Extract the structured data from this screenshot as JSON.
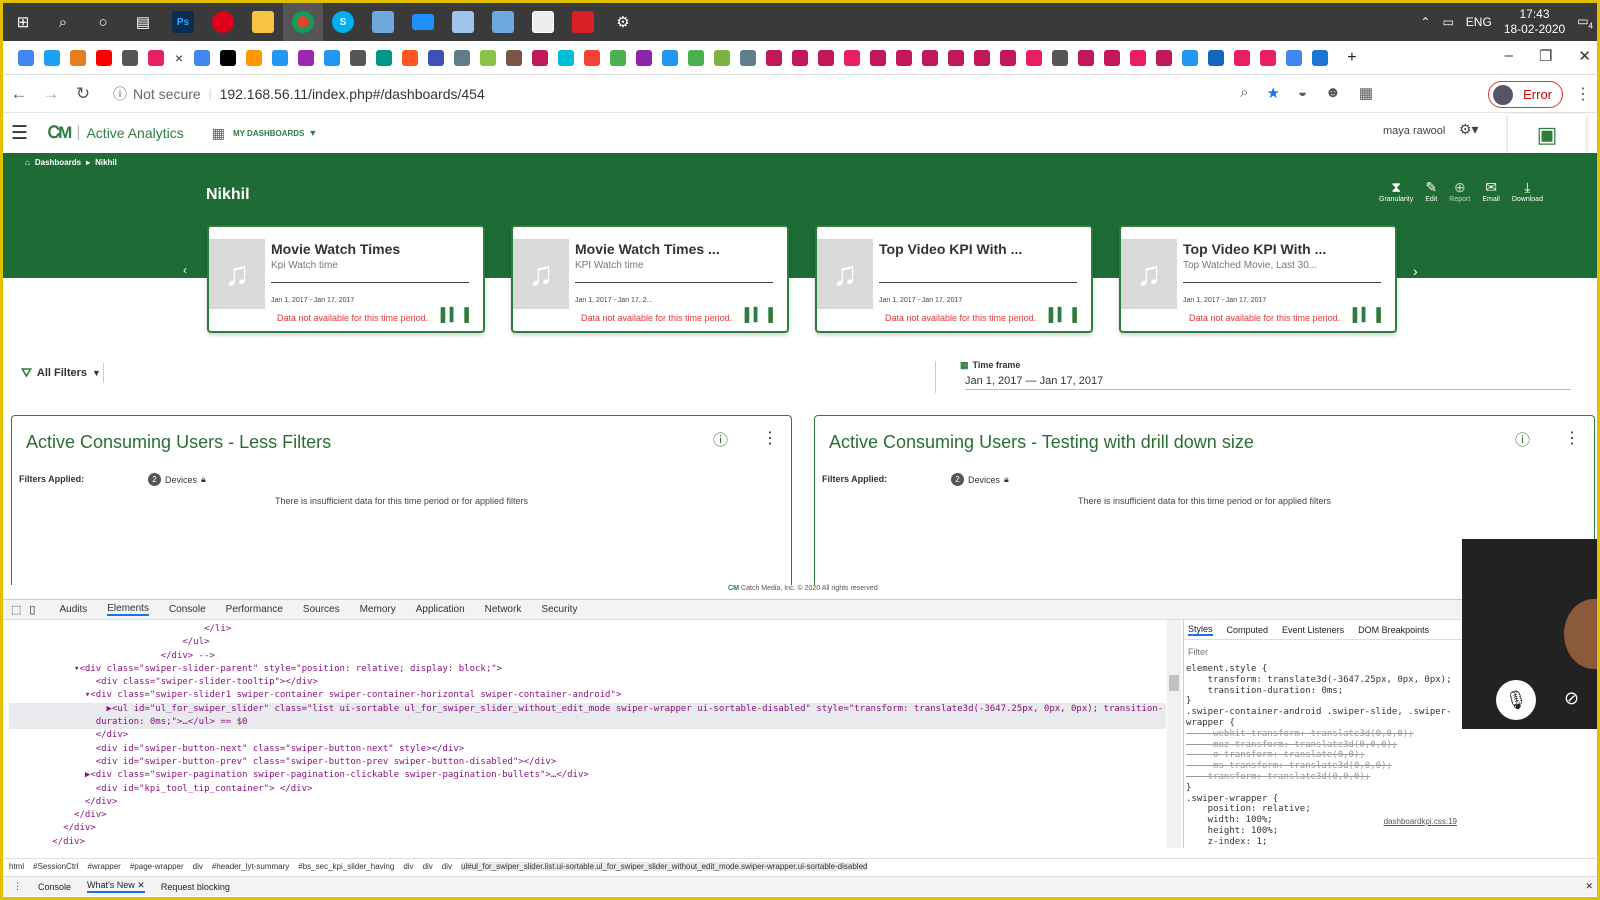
{
  "taskbar": {
    "time": "17:43",
    "date": "18-02-2020",
    "lang": "ENG",
    "notif_count": "4",
    "icons": [
      "windows-icon",
      "search-icon",
      "cortana-icon",
      "task-view-icon",
      "photoshop-icon",
      "opera-icon",
      "file-explorer-icon",
      "chrome-icon",
      "skype-icon",
      "virtualbox-icon",
      "screen-icon",
      "notebook-icon",
      "cube-icon",
      "photos-icon",
      "creative-cloud-icon",
      "settings-icon"
    ],
    "ps_label": "Ps",
    "skype_label": "S"
  },
  "browser": {
    "tab_close": "×",
    "new_tab": "+",
    "url": "192.168.56.11/index.php#/dashboards/454",
    "not_secure": "Not secure",
    "error_label": "Error",
    "fav_colors": [
      "#4285f4",
      "#1da1f2",
      "#e67e22",
      "#ff0000",
      "#555",
      "#e91e63",
      "#4285f4",
      "#000",
      "#ff9800",
      "#2196f3",
      "#9c27b0",
      "#2196f3",
      "#555",
      "#009688",
      "#ff5722",
      "#3f51b5",
      "#607d8b",
      "#8bc34a",
      "#795548",
      "#c2185b",
      "#00bcd4",
      "#f44336",
      "#4caf50",
      "#8e24aa",
      "#2196f3",
      "#4caf50",
      "#7cb342",
      "#607d8b",
      "#c2185b",
      "#c2185b",
      "#c2185b",
      "#e91e63",
      "#c2185b",
      "#c2185b",
      "#c2185b",
      "#c2185b",
      "#c2185b",
      "#c2185b",
      "#e91e63",
      "#555",
      "#c2185b",
      "#c2185b",
      "#e91e63",
      "#c2185b",
      "#2196f3",
      "#1565c0",
      "#e91e63",
      "#e91e63",
      "#4285f4",
      "#1976d2"
    ]
  },
  "app": {
    "name": "Active Analytics",
    "my_dashboards": "MY DASHBOARDS",
    "user": "maya rawool",
    "breadcrumb": [
      "Dashboards",
      "Nikhil"
    ],
    "dashboard_title": "Nikhil",
    "actions": [
      "Granularity",
      "Edit",
      "Report",
      "Email",
      "Download"
    ]
  },
  "kpis": [
    {
      "title": "Movie Watch Times",
      "sub": "Kpi Watch time",
      "dates": "Jan 1, 2017 - Jan 17, 2017",
      "nodata": "Data not available for this time period."
    },
    {
      "title": "Movie Watch Times ...",
      "sub": "KPI Watch time",
      "dates": "Jan 1, 2017 - Jan 17, 2...",
      "nodata": "Data not available for this time period."
    },
    {
      "title": "Top Video KPI With ...",
      "sub": "",
      "dates": "Jan 1, 2017 - Jan 17, 2017",
      "nodata": "Data not available for this time period."
    },
    {
      "title": "Top Video KPI With ...",
      "sub": "Top Watched Movie, Last 30...",
      "dates": "Jan 1, 2017 - Jan 17, 2017",
      "nodata": "Data not available for this time period."
    }
  ],
  "filters": {
    "label": "All Filters",
    "timeframe_label": "Time frame",
    "timeframe_value": "Jan 1, 2017 — Jan 17, 2017"
  },
  "panels": [
    {
      "title": "Active Consuming Users - Less Filters",
      "filters_label": "Filters Applied:",
      "chip_count": "2",
      "chip_label": "Devices",
      "message": "There is insufficient data for this time period or for applied filters"
    },
    {
      "title": "Active Consuming Users - Testing with drill down size",
      "filters_label": "Filters Applied:",
      "chip_count": "2",
      "chip_label": "Devices",
      "message": "There is insufficient data for this time period or for applied filters"
    }
  ],
  "footer": "Catch Media, Inc. © 2020 All rights reserved",
  "devtools": {
    "tabs": [
      "Audits",
      "Elements",
      "Console",
      "Performance",
      "Sources",
      "Memory",
      "Application",
      "Network",
      "Security"
    ],
    "side_tabs": [
      "Styles",
      "Computed",
      "Event Listeners",
      "DOM Breakpoints"
    ],
    "filter_placeholder": "Filter",
    "code_lines": [
      "                                    </li>",
      "                                </ul>",
      "                            </div> -->",
      "            ▾<div class=\"swiper-slider-parent\" style=\"position: relative; display: block;\">",
      "                <div class=\"swiper-slider-tooltip\"></div>",
      "              ▾<div class=\"swiper-slider1 swiper-container swiper-container-horizontal swiper-container-android\">",
      "                  ▶<ul id=\"ul_for_swiper_slider\" class=\"list ui-sortable ul_for_swiper_slider_without_edit_mode swiper-wrapper ui-sortable-disabled\" style=\"transform: translate3d(-3647.25px, 0px, 0px); transition-",
      "                duration: 0ms;\">…</ul> == $0",
      "                </div>",
      "                <div id=\"swiper-button-next\" class=\"swiper-button-next\" style></div>",
      "                <div id=\"swiper-button-prev\" class=\"swiper-button-prev swiper-button-disabled\"></div>",
      "              ▶<div class=\"swiper-pagination swiper-pagination-clickable swiper-pagination-bullets\">…</div>",
      "                <div id=\"kpi_tool_tip_container\"> </div>",
      "              </div>",
      "            </div>",
      "          </div>",
      "        </div>"
    ],
    "css_lines": [
      "element.style {",
      "    transform: translate3d(-3647.25px, 0px, 0px);",
      "    transition-duration: 0ms;",
      "}",
      ".swiper-container-android .swiper-slide, .swiper-",
      "wrapper {",
      "    -webkit-transform: translate3d(0,0,0);",
      "    -moz-transform: translate3d(0,0,0);",
      "    -o-transform: translate(0,0);",
      "    -ms-transform: translate3d(0,0,0);",
      "    transform: translate3d(0,0,0);",
      "}",
      ".swiper-wrapper {",
      "    position: relative;",
      "    width: 100%;",
      "    height: 100%;",
      "    z-index: 1;"
    ],
    "css_source": "dashboardkpi.css:19",
    "breadcrumbs": [
      "html",
      "#SessionCtrl",
      "#wrapper",
      "#page-wrapper",
      "div",
      "#header_lyt-summary",
      "#bs_sec_kpi_slider_having",
      "div",
      "div",
      "div",
      "ul#ul_for_swiper_slider.list.ui-sortable.ul_for_swiper_slider_without_edit_mode.swiper-wrapper.ui-sortable-disabled"
    ],
    "drawer_tabs": [
      "Console",
      "What's New",
      "Request blocking"
    ]
  }
}
